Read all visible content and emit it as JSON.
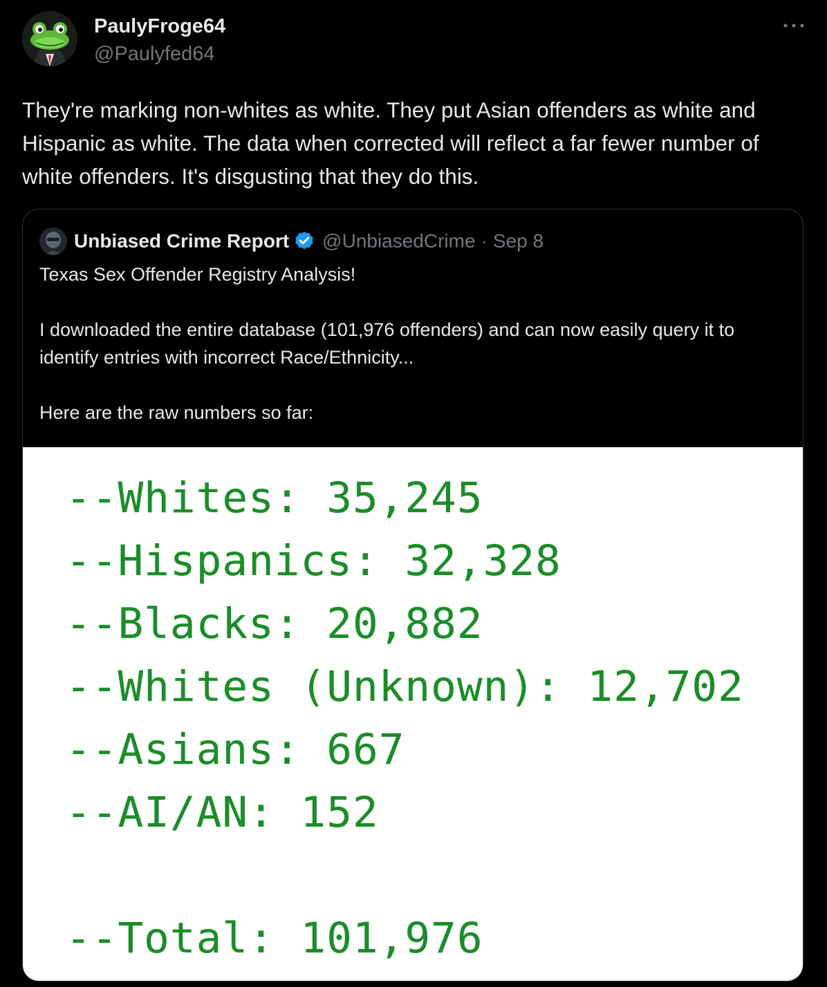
{
  "author": {
    "display_name": "PaulyFroge64",
    "handle": "@Paulyfed64",
    "avatar_icon": "frog-avatar-icon"
  },
  "tweet": {
    "text": "They're marking non-whites as white. They put Asian offenders as white and Hispanic as white. The data when corrected will reflect a far fewer number of white offenders. It's disgusting that they do this.",
    "more_icon": "more-dots-icon"
  },
  "quoted": {
    "display_name": "Unbiased Crime Report",
    "verified": true,
    "handle": "@UnbiasedCrime",
    "separator": "·",
    "date": "Sep 8",
    "paragraphs": [
      "Texas Sex Offender Registry Analysis!",
      "I downloaded the entire database (101,976 offenders) and can now easily query it to identify entries with incorrect Race/Ethnicity...",
      "Here are the raw numbers so far:"
    ],
    "image_lines": [
      "--Whites: 35,245",
      "--Hispanics: 32,328",
      "--Blacks: 20,882",
      "--Whites (Unknown): 12,702",
      "--Asians: 667",
      "--AI/AN: 152",
      "--Total: 101,976"
    ]
  },
  "colors": {
    "background": "#000000",
    "text_primary": "#e7e9ea",
    "text_secondary": "#71767b",
    "border": "#2f3336",
    "verified": "#1d9bf0",
    "code_green": "#1c8c2a"
  }
}
